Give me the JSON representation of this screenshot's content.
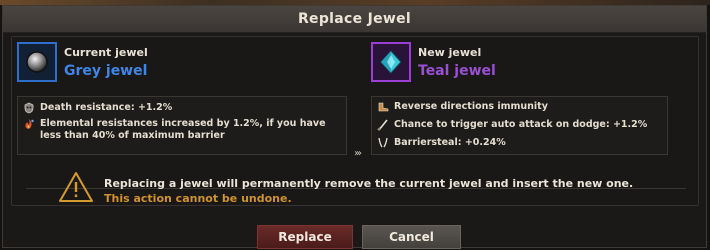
{
  "title": "Replace Jewel",
  "current": {
    "label": "Current jewel",
    "name": "Grey jewel",
    "icon": "grey-orb-icon",
    "stats": [
      {
        "icon": "skull-shield-icon",
        "text": "Death resistance: +1.2%"
      },
      {
        "icon": "elemental-flame-icon",
        "text": "Elemental resistances increased by 1.2%, if you have less than 40% of maximum barrier"
      }
    ]
  },
  "separator_arrows": "›››",
  "new": {
    "label": "New jewel",
    "name": "Teal jewel",
    "icon": "teal-crystal-icon",
    "stats": [
      {
        "icon": "boot-icon",
        "text": "Reverse directions immunity"
      },
      {
        "icon": "slash-icon",
        "text": "Chance to trigger auto attack on dodge: +1.2%"
      },
      {
        "icon": "fang-icon",
        "text": "Barriersteal: +0.24%"
      }
    ]
  },
  "warning": {
    "icon": "warning-triangle-icon",
    "message": "Replacing a jewel will permanently remove the current jewel and insert the new one.",
    "note": "This action cannot be undone."
  },
  "buttons": {
    "replace": "Replace",
    "cancel": "Cancel"
  },
  "colors": {
    "grey_jewel": "#3f86e6",
    "teal_jewel": "#9a4fd4",
    "warning_note": "#d0922c",
    "replace_button": "#5a2322"
  }
}
